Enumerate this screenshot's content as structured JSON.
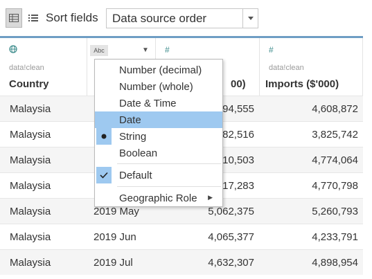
{
  "toolbar": {
    "grid_view_icon": "grid-view-icon",
    "list_view_icon": "list-view-icon",
    "sort_label": "Sort fields",
    "sort_value": "Data source order"
  },
  "columns": [
    {
      "type_icon": "globe-icon",
      "source": "data!clean",
      "name": "Country"
    },
    {
      "type_icon": "abc-icon",
      "type_text": "Abc",
      "source": "",
      "name": ""
    },
    {
      "type_icon": "number-icon",
      "type_text": "#",
      "source": "",
      "name": "00)"
    },
    {
      "type_icon": "number-icon",
      "type_text": "#",
      "source": "data!clean",
      "name": "Imports ($'000)"
    }
  ],
  "rows": [
    {
      "country": "Malaysia",
      "month": "",
      "exports": "94,555",
      "imports": "4,608,872"
    },
    {
      "country": "Malaysia",
      "month": "",
      "exports": "82,516",
      "imports": "3,825,742"
    },
    {
      "country": "Malaysia",
      "month": "",
      "exports": "10,503",
      "imports": "4,774,064"
    },
    {
      "country": "Malaysia",
      "month": "",
      "exports": "17,283",
      "imports": "4,770,798"
    },
    {
      "country": "Malaysia",
      "month": "2019 May",
      "exports": "5,062,375",
      "imports": "5,260,793"
    },
    {
      "country": "Malaysia",
      "month": "2019 Jun",
      "exports": "4,065,377",
      "imports": "4,233,791"
    },
    {
      "country": "Malaysia",
      "month": "2019 Jul",
      "exports": "4,632,307",
      "imports": "4,898,954"
    }
  ],
  "menu": {
    "items": [
      {
        "label": "Number (decimal)"
      },
      {
        "label": "Number (whole)"
      },
      {
        "label": "Date & Time"
      },
      {
        "label": "Date",
        "highlighted": true
      },
      {
        "label": "String",
        "checked": "radio"
      },
      {
        "label": "Boolean"
      },
      {
        "label": "Default",
        "checked": "check"
      },
      {
        "label": "Geographic Role",
        "submenu": true
      }
    ]
  },
  "colors": {
    "accent": "#6e9dc4",
    "highlight": "#9ec9f0",
    "type_icon": "#3d8c8c"
  }
}
